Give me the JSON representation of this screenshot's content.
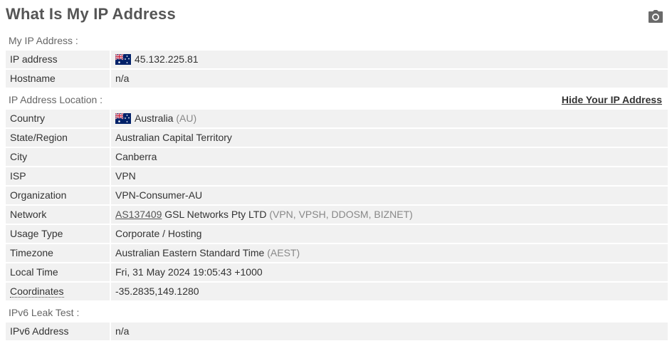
{
  "title": "What Is My IP Address",
  "icons": {
    "screenshot": "camera-icon",
    "flag": "australia-flag-icon"
  },
  "sections": {
    "my_ip": "My IP Address :",
    "location": "IP Address Location :",
    "ipv6": "IPv6 Leak Test :"
  },
  "hide_ip_link": "Hide Your IP Address",
  "my_ip": {
    "ip_label": "IP address",
    "ip_value": "45.132.225.81",
    "hostname_label": "Hostname",
    "hostname_value": "n/a"
  },
  "location": {
    "country_label": "Country",
    "country_value": "Australia",
    "country_code": "(AU)",
    "region_label": "State/Region",
    "region_value": "Australian Capital Territory",
    "city_label": "City",
    "city_value": "Canberra",
    "isp_label": "ISP",
    "isp_value": "VPN",
    "org_label": "Organization",
    "org_value": "VPN-Consumer-AU",
    "network_label": "Network",
    "network_asn": "AS137409",
    "network_name": "GSL Networks Pty LTD",
    "network_tags": "(VPN, VPSH, DDOSM, BIZNET)",
    "usage_label": "Usage Type",
    "usage_value": "Corporate / Hosting",
    "timezone_label": "Timezone",
    "timezone_value": "Australian Eastern Standard Time",
    "timezone_abbr": "(AEST)",
    "localtime_label": "Local Time",
    "localtime_value": "Fri, 31 May 2024 19:05:43 +1000",
    "coords_label": "Coordinates",
    "coords_value": "-35.2835,149.1280"
  },
  "ipv6": {
    "label": "IPv6 Address",
    "value": "n/a"
  },
  "colors": {
    "row_bg": "#f1f1f1",
    "title": "#555555",
    "muted": "#888888",
    "flag_blue": "#012169",
    "flag_red": "#c8102e"
  }
}
